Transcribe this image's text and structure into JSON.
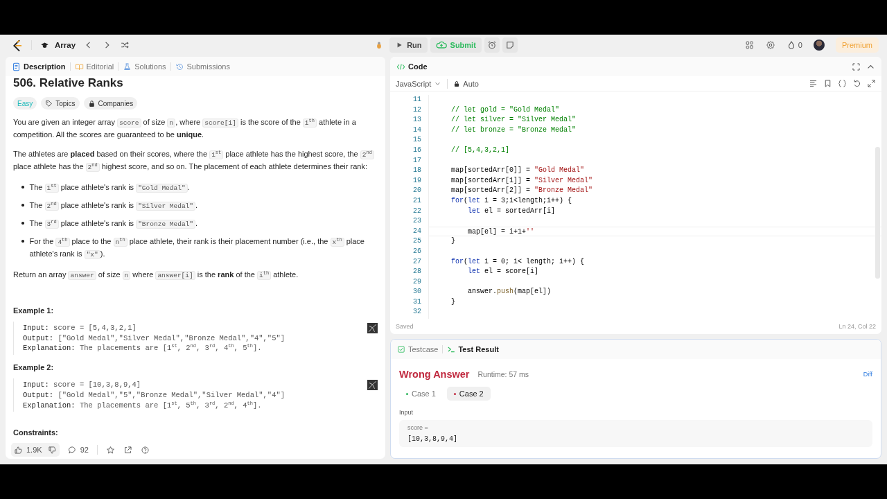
{
  "nav": {
    "list_title": "Array",
    "run": "Run",
    "submit": "Submit",
    "streak": "0",
    "premium": "Premium"
  },
  "left": {
    "tabs": [
      {
        "label": "Description",
        "kind": "description",
        "selected": true
      },
      {
        "label": "Editorial",
        "kind": "editorial",
        "selected": false
      },
      {
        "label": "Solutions",
        "kind": "solutions",
        "selected": false
      },
      {
        "label": "Submissions",
        "kind": "submissions",
        "selected": false
      }
    ],
    "title": "506. Relative Ranks",
    "tags": [
      {
        "label": "Easy",
        "kind": "difficulty"
      },
      {
        "label": "Topics",
        "kind": "topics"
      },
      {
        "label": "Companies",
        "kind": "companies"
      }
    ],
    "paragraphs": [
      {
        "kind": "paragraph",
        "parts": [
          {
            "kind": "text",
            "text": "You are given an integer array "
          },
          {
            "kind": "code",
            "text": "score"
          },
          {
            "kind": "text",
            "text": " of size "
          },
          {
            "kind": "code",
            "text": "n"
          },
          {
            "kind": "text",
            "text": ", where "
          },
          {
            "kind": "code",
            "text": "score[i]"
          },
          {
            "kind": "text",
            "text": " is the score of the "
          },
          {
            "kind": "code",
            "text": "i$^{th}$"
          },
          {
            "kind": "text",
            "text": " athlete in a competition. All the scores are guaranteed to be **unique**."
          }
        ]
      },
      {
        "kind": "paragraph",
        "parts": [
          {
            "kind": "text",
            "text": "The athletes are **placed** based on their scores, where the "
          },
          {
            "kind": "code",
            "text": "1$^{st}$"
          },
          {
            "kind": "text",
            "text": " place athlete has the highest score, the "
          },
          {
            "kind": "code",
            "text": "2$^{nd}$"
          },
          {
            "kind": "text",
            "text": " place athlete has the "
          },
          {
            "kind": "code",
            "text": "2$^{nd}$"
          },
          {
            "kind": "text",
            "text": " highest score, and so on. The placement of each athlete determines their rank:"
          }
        ]
      },
      {
        "kind": "bullet",
        "parts": [
          {
            "kind": "text",
            "text": "The "
          },
          {
            "kind": "code",
            "text": "1$^{st}$"
          },
          {
            "kind": "text",
            "text": " place athlete's rank is "
          },
          {
            "kind": "code",
            "text": "\"Gold Medal\""
          },
          {
            "kind": "text",
            "text": "."
          }
        ]
      },
      {
        "kind": "bullet",
        "parts": [
          {
            "kind": "text",
            "text": "The "
          },
          {
            "kind": "code",
            "text": "2$^{nd}$"
          },
          {
            "kind": "text",
            "text": " place athlete's rank is "
          },
          {
            "kind": "code",
            "text": "\"Silver Medal\""
          },
          {
            "kind": "text",
            "text": "."
          }
        ]
      },
      {
        "kind": "bullet",
        "parts": [
          {
            "kind": "text",
            "text": "The "
          },
          {
            "kind": "code",
            "text": "3$^{rd}$"
          },
          {
            "kind": "text",
            "text": " place athlete's rank is "
          },
          {
            "kind": "code",
            "text": "\"Bronze Medal\""
          },
          {
            "kind": "text",
            "text": "."
          }
        ]
      },
      {
        "kind": "bullet",
        "parts": [
          {
            "kind": "text",
            "text": "For the "
          },
          {
            "kind": "code",
            "text": "4$^{th}$"
          },
          {
            "kind": "text",
            "text": " place to the "
          },
          {
            "kind": "code",
            "text": "n$^{th}$"
          },
          {
            "kind": "text",
            "text": " place athlete, their rank is their placement number (i.e., the "
          },
          {
            "kind": "code",
            "text": "x$^{th}$"
          },
          {
            "kind": "text",
            "text": " place athlete's rank is "
          },
          {
            "kind": "code",
            "text": "\"x\""
          },
          {
            "kind": "text",
            "text": ")."
          }
        ]
      },
      {
        "kind": "paragraph",
        "parts": [
          {
            "kind": "text",
            "text": "Return an array "
          },
          {
            "kind": "code",
            "text": "answer"
          },
          {
            "kind": "text",
            "text": " of size "
          },
          {
            "kind": "code",
            "text": "n"
          },
          {
            "kind": "text",
            "text": " where "
          },
          {
            "kind": "code",
            "text": "answer[i]"
          },
          {
            "kind": "text",
            "text": " is the **rank** of the "
          },
          {
            "kind": "code",
            "text": "i$^{th}$"
          },
          {
            "kind": "text",
            "text": " athlete."
          }
        ]
      }
    ],
    "examples": [
      {
        "title": "Example 1:",
        "lines": [
          {
            "label": "Input:",
            "value": "score = [5,4,3,2,1]"
          },
          {
            "label": "Output:",
            "value": "[\"Gold Medal\",\"Silver Medal\",\"Bronze Medal\",\"4\",\"5\"]"
          },
          {
            "label": "Explanation:",
            "value": "The placements are [1$^{st}$, 2$^{nd}$, 3$^{rd}$, 4$^{th}$, 5$^{th}$]."
          }
        ]
      },
      {
        "title": "Example 2:",
        "lines": [
          {
            "label": "Input:",
            "value": "score = [10,3,8,9,4]"
          },
          {
            "label": "Output:",
            "value": "[\"Gold Medal\",\"5\",\"Bronze Medal\",\"Silver Medal\",\"4\"]"
          },
          {
            "label": "Explanation:",
            "value": "The placements are [1$^{st}$, 5$^{th}$, 3$^{rd}$, 2$^{nd}$, 4$^{th}$]."
          }
        ]
      }
    ],
    "next_heading": "Constraints:",
    "footer": {
      "likes": "1.9K",
      "comments": "92"
    }
  },
  "editor": {
    "title": "Code",
    "language": "JavaScript",
    "mode": "Auto",
    "lines": [
      {
        "number": "11"
      },
      {
        "number": "12",
        "tokens": [
          {
            "kind": "comment",
            "text": "    // let gold = \"Gold Medal\""
          }
        ]
      },
      {
        "number": "13",
        "tokens": [
          {
            "kind": "comment",
            "text": "    // let silver = \"Silver Medal\""
          }
        ]
      },
      {
        "number": "14",
        "tokens": [
          {
            "kind": "comment",
            "text": "    // let bronze = \"Bronze Medal\""
          }
        ]
      },
      {
        "number": "15"
      },
      {
        "number": "16",
        "tokens": [
          {
            "kind": "comment",
            "text": "    // [5,4,3,2,1]"
          }
        ]
      },
      {
        "number": "17"
      },
      {
        "number": "18",
        "tokens": [
          {
            "kind": "plain",
            "text": "    map[sortedArr[0]] = "
          },
          {
            "kind": "string",
            "text": "\"Gold Medal\""
          }
        ]
      },
      {
        "number": "19",
        "tokens": [
          {
            "kind": "plain",
            "text": "    map[sortedArr[1]] = "
          },
          {
            "kind": "string",
            "text": "\"Silver Medal\""
          }
        ]
      },
      {
        "number": "20",
        "tokens": [
          {
            "kind": "plain",
            "text": "    map[sortedArr[2]] = "
          },
          {
            "kind": "string",
            "text": "\"Bronze Medal\""
          }
        ]
      },
      {
        "number": "21",
        "tokens": [
          {
            "kind": "keyword",
            "text": "    for"
          },
          {
            "kind": "plain",
            "text": "("
          },
          {
            "kind": "keyword",
            "text": "let"
          },
          {
            "kind": "plain",
            "text": " i = 3;i<length;i++) {"
          }
        ]
      },
      {
        "number": "22",
        "tokens": [
          {
            "kind": "keyword",
            "text": "        let"
          },
          {
            "kind": "plain",
            "text": " el = sortedArr[i]"
          }
        ]
      },
      {
        "number": "23"
      },
      {
        "number": "24",
        "current": true,
        "tokens": [
          {
            "kind": "plain",
            "text": "        map[el] = i+1+"
          },
          {
            "kind": "string",
            "text": "''"
          }
        ]
      },
      {
        "number": "25",
        "tokens": [
          {
            "kind": "plain",
            "text": "    }"
          }
        ]
      },
      {
        "number": "26"
      },
      {
        "number": "27",
        "tokens": [
          {
            "kind": "keyword",
            "text": "    for"
          },
          {
            "kind": "plain",
            "text": "("
          },
          {
            "kind": "keyword",
            "text": "let"
          },
          {
            "kind": "plain",
            "text": " i = 0; i< length; i++) {"
          }
        ]
      },
      {
        "number": "28",
        "tokens": [
          {
            "kind": "keyword",
            "text": "        let"
          },
          {
            "kind": "plain",
            "text": " el = score[i]"
          }
        ]
      },
      {
        "number": "29"
      },
      {
        "number": "30",
        "tokens": [
          {
            "kind": "plain",
            "text": "        answer."
          },
          {
            "kind": "function",
            "text": "push"
          },
          {
            "kind": "plain",
            "text": "(map[el])"
          }
        ]
      },
      {
        "number": "31",
        "tokens": [
          {
            "kind": "plain",
            "text": "    }"
          }
        ]
      },
      {
        "number": "32"
      }
    ],
    "status": "Saved",
    "position": "Ln 24, Col 22"
  },
  "result": {
    "tabs": [
      {
        "label": "Testcase",
        "kind": "testcase",
        "selected": false
      },
      {
        "label": "Test Result",
        "kind": "result",
        "selected": true
      }
    ],
    "verdict": "Wrong Answer",
    "runtime": "Runtime: 57 ms",
    "diff": "Diff",
    "cases": [
      {
        "label": "Case 1",
        "color": "#2db55d",
        "selected": false
      },
      {
        "label": "Case 2",
        "color": "#c0283e",
        "selected": true
      }
    ],
    "input_label": "Input",
    "param_name": "score =",
    "param_value": "[10,3,8,9,4]"
  }
}
